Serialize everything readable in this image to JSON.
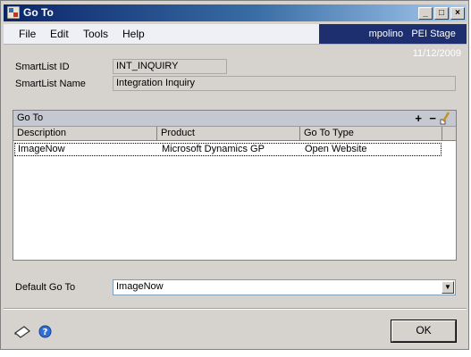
{
  "window": {
    "title": "Go To"
  },
  "menu": {
    "file": "File",
    "edit": "Edit",
    "tools": "Tools",
    "help": "Help"
  },
  "status": {
    "user": "mpolino",
    "company": "PEI Stage",
    "date": "11/12/2009"
  },
  "smartlist": {
    "id_label": "SmartList ID",
    "id_value": "INT_INQUIRY",
    "name_label": "SmartList Name",
    "name_value": "Integration Inquiry"
  },
  "grid": {
    "title": "Go To",
    "columns": [
      "Description",
      "Product",
      "Go To Type"
    ],
    "rows": [
      {
        "description": "ImageNow",
        "product": "Microsoft Dynamics GP",
        "type": "Open Website"
      }
    ]
  },
  "default_goto": {
    "label": "Default Go To",
    "value": "ImageNow"
  },
  "buttons": {
    "ok": "OK"
  },
  "icons": {
    "title": "goto-window-icon",
    "add": "add-icon",
    "remove": "remove-icon",
    "edit": "pencil-icon",
    "note": "note-icon",
    "help": "help-icon"
  }
}
